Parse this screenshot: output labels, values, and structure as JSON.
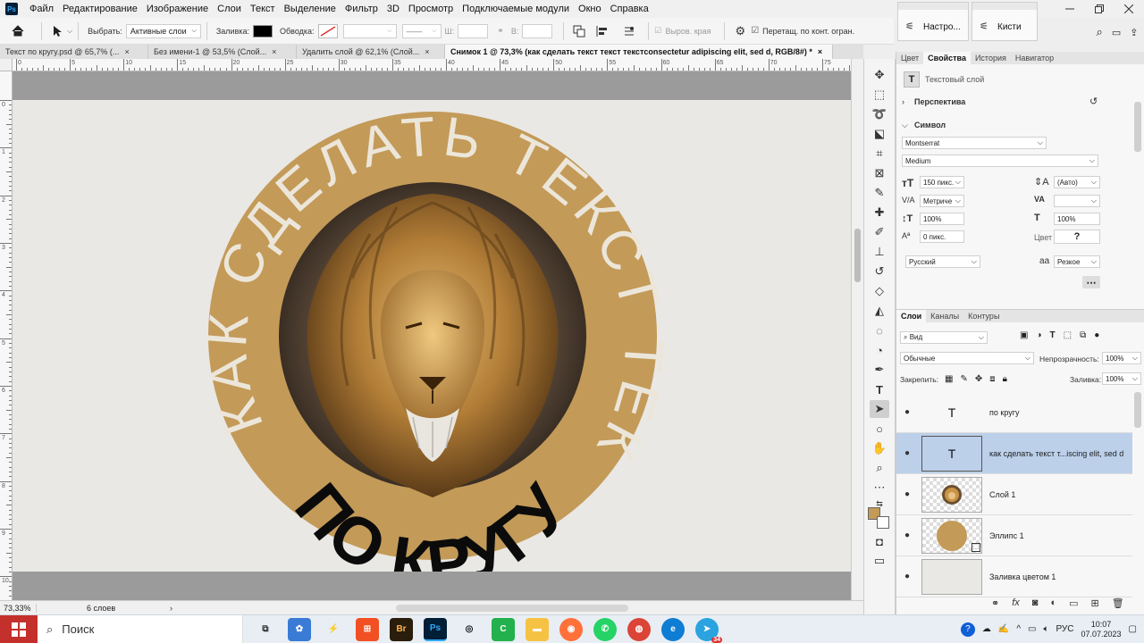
{
  "app": {
    "logo": "Ps"
  },
  "menu": [
    "Файл",
    "Редактирование",
    "Изображение",
    "Слои",
    "Текст",
    "Выделение",
    "Фильтр",
    "3D",
    "Просмотр",
    "Подключаемые модули",
    "Окно",
    "Справка"
  ],
  "options": {
    "select_label": "Выбрать:",
    "select_value": "Активные слои",
    "fill_label": "Заливка:",
    "stroke_label": "Обводка:",
    "w_label": "Ш:",
    "h_label": "В:",
    "align_edges": "Выров. края",
    "drag_label": "Перетащ. по конт. огран."
  },
  "mini_panels": [
    {
      "title": "Настро..."
    },
    {
      "title": "Кисти"
    }
  ],
  "tabs": [
    {
      "label": "Текст по кругу.psd @ 65,7% (...",
      "active": false
    },
    {
      "label": "Без имени-1 @ 53,5% (Слой...",
      "active": false
    },
    {
      "label": "Удалить слой @ 62,1% (Слой...",
      "active": false
    },
    {
      "label": "Снимок 1 @ 73,3% (как сделать текст текст текстconsectetur adipiscing elit, sed d, RGB/8#) *",
      "active": true
    }
  ],
  "ruler_h": [
    "0",
    "5",
    "10",
    "15",
    "20",
    "25",
    "30",
    "35",
    "40",
    "45",
    "50",
    "55",
    "60",
    "65",
    "70",
    "75"
  ],
  "ruler_v": [
    "0",
    "1",
    "2",
    "3",
    "4",
    "5",
    "6",
    "7",
    "8",
    "9",
    "10"
  ],
  "artwork": {
    "top_text": "КАК СДЕЛАТЬ ТЕКСТ ТЕКСТ",
    "bottom_text": "ПО КРУГУ",
    "ring_color": "#c39a58",
    "top_text_color": "#ece6da",
    "bottom_text_color": "#0b0b0b"
  },
  "status": {
    "zoom": "73,33%",
    "layers_count": "6 слоев"
  },
  "properties": {
    "tabs": [
      "Цвет",
      "Свойства",
      "История",
      "Навигатор"
    ],
    "active_tab": "Свойства",
    "layer_type": "Текстовый слой",
    "perspective": "Перспектива",
    "symbol": "Символ",
    "font_family": "Montserrat",
    "font_style": "Medium",
    "size": "150 пикс.",
    "leading": "(Авто)",
    "kerning": "Метриче",
    "vscale": "100%",
    "hscale": "100%",
    "baseline": "0 пикс.",
    "color_label": "Цвет",
    "color_value": "?",
    "language": "Русский",
    "antialias_label": "а",
    "antialias": "Резкое"
  },
  "layers": {
    "tabs": [
      "Слои",
      "Каналы",
      "Контуры"
    ],
    "filter": "Вид",
    "blend": "Обычные",
    "opacity_label": "Непрозрачность:",
    "opacity": "100%",
    "lock_label": "Закрепить:",
    "fill_label": "Заливка:",
    "fill": "100%",
    "items": [
      {
        "name": "по кругу",
        "thumb": "T",
        "selected": false
      },
      {
        "name": "как сделать текст т...iscing elit, sed d",
        "thumb": "T",
        "selected": true
      },
      {
        "name": "Слой 1",
        "thumb": "lion",
        "selected": false
      },
      {
        "name": "Эллипс 1",
        "thumb": "ellipse",
        "selected": false
      },
      {
        "name": "Заливка цветом 1",
        "thumb": "fill",
        "selected": false
      }
    ]
  },
  "taskbar": {
    "search": "Поиск",
    "lang": "РУС",
    "time": "10:07",
    "date": "07.07.2023",
    "badge": "34"
  },
  "colors": {
    "foreground": "#c39a58",
    "selection": "#bcd0ea",
    "canvas": "#e9e8e4"
  }
}
